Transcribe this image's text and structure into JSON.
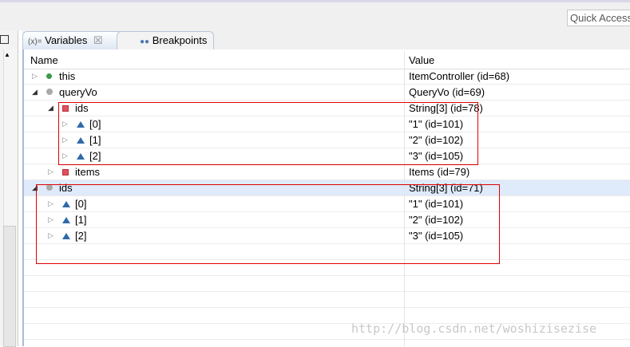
{
  "toolbar": {
    "quick_access": "Quick Access"
  },
  "tabs": [
    {
      "label": "Variables",
      "prefix": "(x)=",
      "close": "☒"
    },
    {
      "label": "Breakpoints"
    }
  ],
  "columns": {
    "name": "Name",
    "value": "Value"
  },
  "rows": [
    {
      "name": "this",
      "value": "ItemController  (id=68)"
    },
    {
      "name": "queryVo",
      "value": "QueryVo  (id=69)"
    },
    {
      "name": "ids",
      "value": "String[3]  (id=78)"
    },
    {
      "name": "[0]",
      "value": "\"1\" (id=101)"
    },
    {
      "name": "[1]",
      "value": "\"2\" (id=102)"
    },
    {
      "name": "[2]",
      "value": "\"3\" (id=105)"
    },
    {
      "name": "items",
      "value": "Items  (id=79)"
    },
    {
      "name": "ids",
      "value": "String[3]  (id=71)"
    },
    {
      "name": "[0]",
      "value": "\"1\" (id=101)"
    },
    {
      "name": "[1]",
      "value": "\"2\" (id=102)"
    },
    {
      "name": "[2]",
      "value": "\"3\" (id=105)"
    }
  ],
  "watermark": "http://blog.csdn.net/woshizisezise"
}
